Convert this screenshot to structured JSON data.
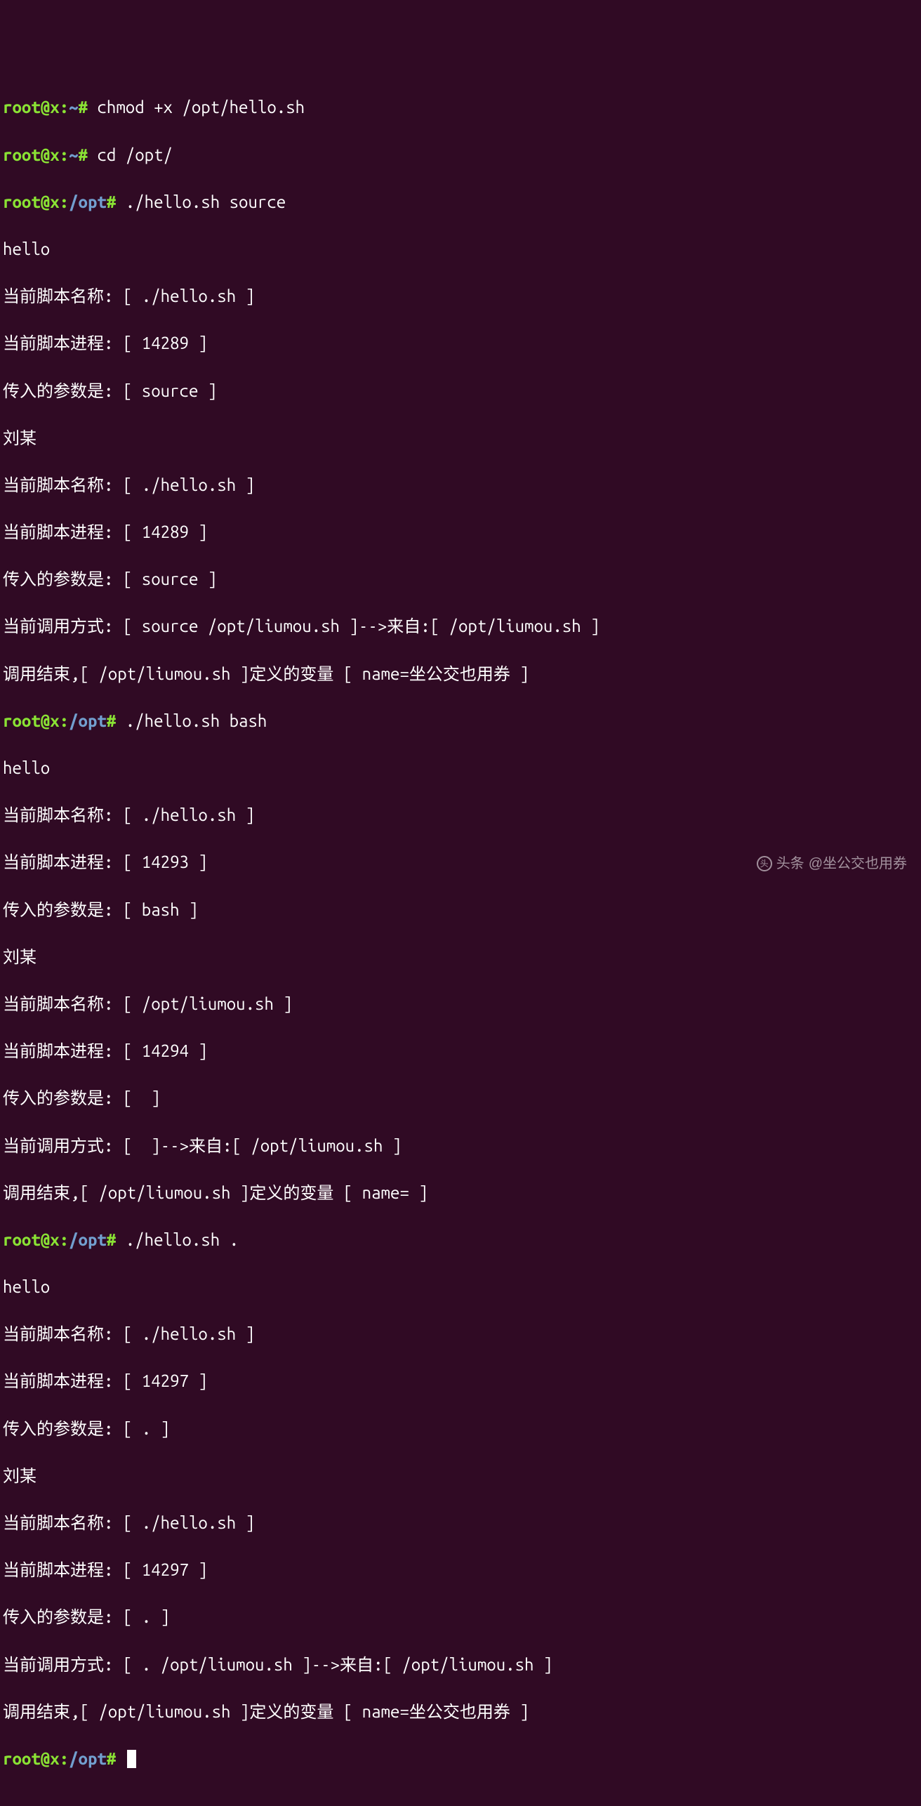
{
  "prompts": {
    "p1": {
      "user": "root@x",
      "path": "~",
      "sep": "#",
      "cmd": " chmod +x /opt/hello.sh "
    },
    "p2": {
      "user": "root@x",
      "path": "~",
      "sep": "#",
      "cmd": " cd /opt/ "
    },
    "p3": {
      "user": "root@x",
      "path": "/opt",
      "sep": "#",
      "cmd": " ./hello.sh source "
    },
    "p4": {
      "user": "root@x",
      "path": "/opt",
      "sep": "#",
      "cmd": " ./hello.sh bash "
    },
    "p5": {
      "user": "root@x",
      "path": "/opt",
      "sep": "#",
      "cmd": " ./hello.sh . "
    },
    "p6": {
      "user": "root@x",
      "path": "/opt",
      "sep": "#",
      "cmd": " "
    }
  },
  "out": {
    "o01": "hello",
    "o02": "当前脚本名称: [ ./hello.sh ]",
    "o03": "当前脚本进程: [ 14289 ]",
    "o04": "传入的参数是: [ source ]",
    "o05": "刘某",
    "o06": "当前脚本名称: [ ./hello.sh ]",
    "o07": "当前脚本进程: [ 14289 ]",
    "o08": "传入的参数是: [ source ]",
    "o09": "当前调用方式: [ source /opt/liumou.sh ]-->来自:[ /opt/liumou.sh ]",
    "o10": "调用结束,[ /opt/liumou.sh ]定义的变量 [ name=坐公交也用券 ]",
    "o11": "hello",
    "o12": "当前脚本名称: [ ./hello.sh ]",
    "o13": "当前脚本进程: [ 14293 ]",
    "o14": "传入的参数是: [ bash ]",
    "o15": "刘某",
    "o16": "当前脚本名称: [ /opt/liumou.sh ]",
    "o17": "当前脚本进程: [ 14294 ]",
    "o18": "传入的参数是: [  ]",
    "o19": "当前调用方式: [  ]-->来自:[ /opt/liumou.sh ]",
    "o20": "调用结束,[ /opt/liumou.sh ]定义的变量 [ name= ]",
    "o21": "hello",
    "o22": "当前脚本名称: [ ./hello.sh ]",
    "o23": "当前脚本进程: [ 14297 ]",
    "o24": "传入的参数是: [ . ]",
    "o25": "刘某",
    "o26": "当前脚本名称: [ ./hello.sh ]",
    "o27": "当前脚本进程: [ 14297 ]",
    "o28": "传入的参数是: [ . ]",
    "o29": "当前调用方式: [ . /opt/liumou.sh ]-->来自:[ /opt/liumou.sh ]",
    "o30": "调用结束,[ /opt/liumou.sh ]定义的变量 [ name=坐公交也用券 ]"
  },
  "watermark": {
    "label": "头条",
    "handle": "@坐公交也用券"
  }
}
